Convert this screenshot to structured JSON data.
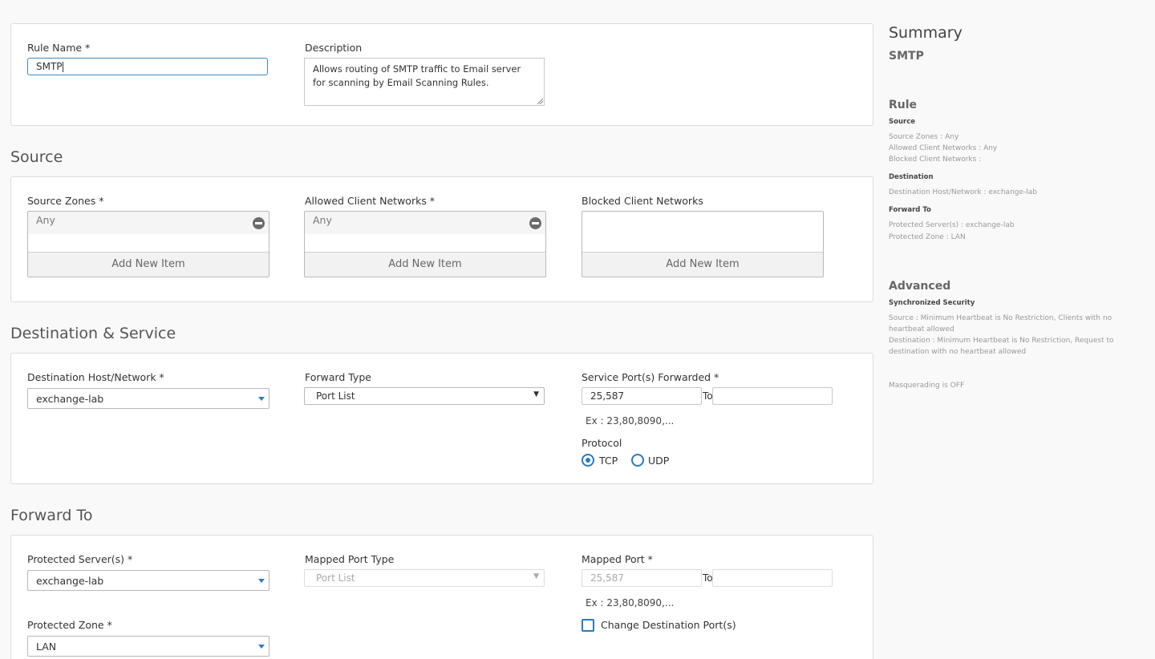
{
  "general": {
    "rule_name_label": "Rule Name *",
    "rule_name_value": "SMTP",
    "description_label": "Description",
    "description_value": "Allows routing of SMTP traffic to Email server for scanning by Email Scanning Rules."
  },
  "source": {
    "title": "Source",
    "zones_label": "Source Zones *",
    "zones_item": "Any",
    "allowed_label": "Allowed Client Networks *",
    "allowed_item": "Any",
    "blocked_label": "Blocked Client Networks",
    "add_new": "Add New Item"
  },
  "destination": {
    "title": "Destination & Service",
    "host_label": "Destination Host/Network *",
    "host_value": "exchange-lab",
    "forward_type_label": "Forward Type",
    "forward_type_value": "Port List",
    "ports_label": "Service Port(s) Forwarded *",
    "ports_value": "25,587",
    "to_label": "To",
    "example": "Ex : 23,80,8090,...",
    "protocol_label": "Protocol",
    "tcp": "TCP",
    "udp": "UDP"
  },
  "forward": {
    "title": "Forward To",
    "servers_label": "Protected Server(s) *",
    "servers_value": "exchange-lab",
    "mapped_type_label": "Mapped Port Type",
    "mapped_type_value": "Port List",
    "mapped_port_label": "Mapped Port *",
    "mapped_port_value": "25,587",
    "to_label": "To",
    "example": "Ex : 23,80,8090,...",
    "change_port_label": "Change Destination Port(s)",
    "zone_label": "Protected Zone *",
    "zone_value": "LAN"
  },
  "summary": {
    "title": "Summary",
    "rule_name": "SMTP",
    "rule_heading": "Rule",
    "source_heading": "Source",
    "source_zones": "Source Zones : Any",
    "allowed_networks": "Allowed Client Networks : Any",
    "blocked_networks": "Blocked Client Networks :",
    "destination_heading": "Destination",
    "destination_host": "Destination Host/Network : exchange-lab",
    "forward_heading": "Forward To",
    "protected_servers": "Protected Server(s) : exchange-lab",
    "protected_zone": "Protected Zone : LAN",
    "advanced_heading": "Advanced",
    "sync_heading": "Synchronized Security",
    "sync_source": "Source : Minimum Heartbeat is No Restriction, Clients with no heartbeat allowed",
    "sync_destination": "Destination : Minimum Heartbeat is No Restriction, Request to destination with no heartbeat allowed",
    "masquerading": "Masquerading is OFF"
  }
}
